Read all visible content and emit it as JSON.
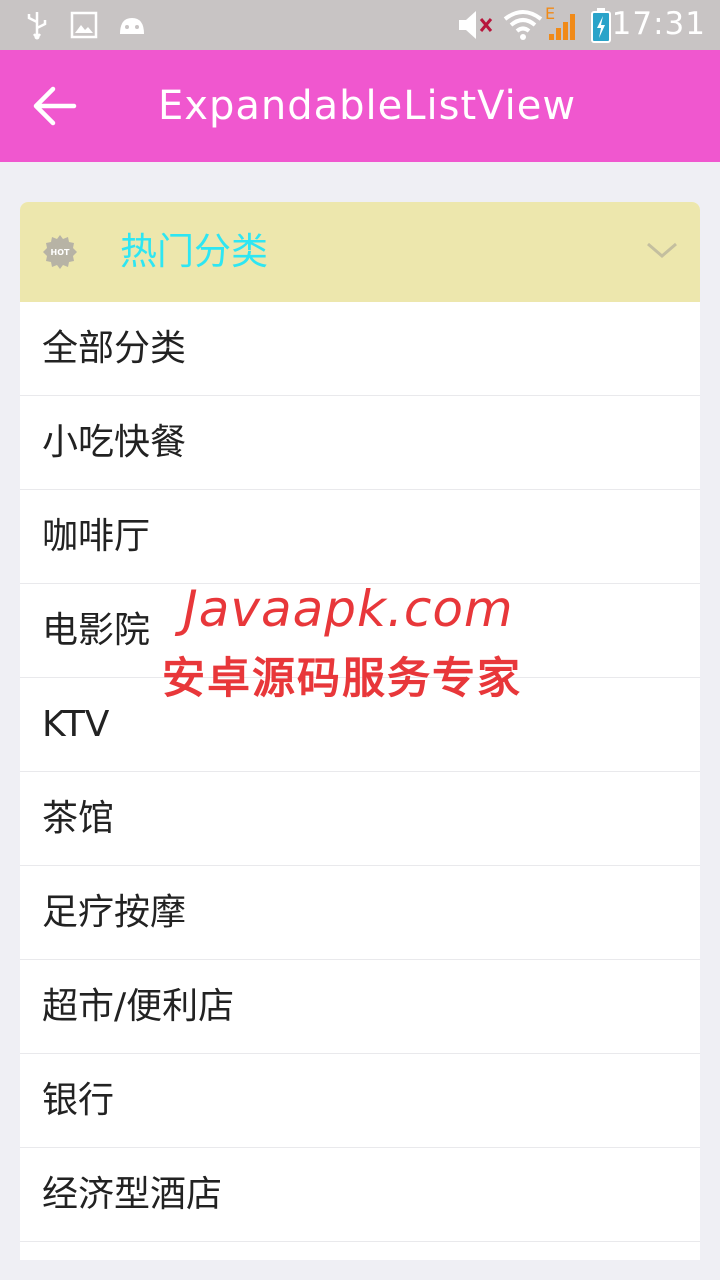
{
  "status_bar": {
    "time": "17:31",
    "icons": [
      "usb-icon",
      "image-icon",
      "android-icon",
      "mute-icon",
      "wifi-icon",
      "signal-icon",
      "battery-charging-icon"
    ],
    "network_letter": "E"
  },
  "app_bar": {
    "title": "ExpandableListView",
    "back_icon": "arrow-back-icon",
    "color": "#f057cf"
  },
  "group": {
    "badge_text": "HOT",
    "title": "热门分类",
    "title_color": "#2ee6f2",
    "header_color": "#ede7ad",
    "expanded": true
  },
  "items": [
    {
      "label": "全部分类"
    },
    {
      "label": "小吃快餐"
    },
    {
      "label": "咖啡厅"
    },
    {
      "label": "电影院"
    },
    {
      "label": "KTV"
    },
    {
      "label": "茶馆"
    },
    {
      "label": "足疗按摩"
    },
    {
      "label": "超市/便利店"
    },
    {
      "label": "银行"
    },
    {
      "label": "经济型酒店"
    }
  ],
  "watermark": {
    "line1": "Javaapk.com",
    "line2": "安卓源码服务专家",
    "color": "#e8373a"
  }
}
